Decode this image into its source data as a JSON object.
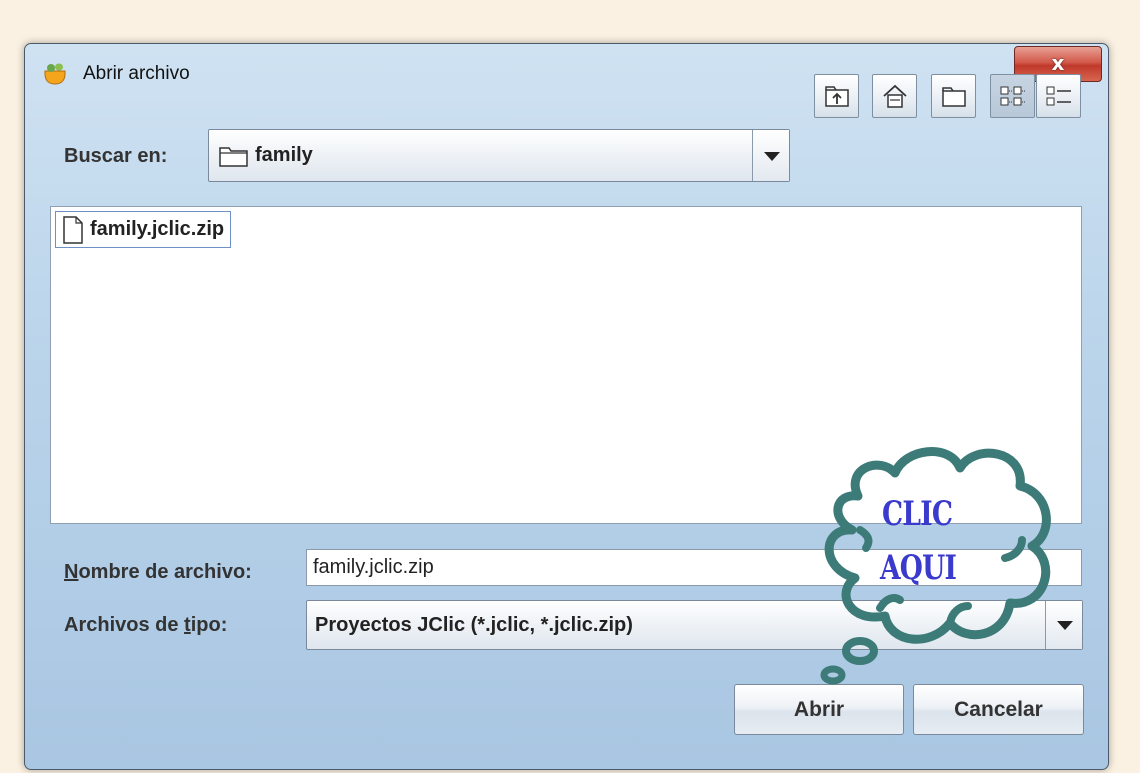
{
  "window": {
    "title": "Abrir archivo",
    "close_label": "x"
  },
  "lookin": {
    "label": "Buscar en:",
    "value": "family"
  },
  "toolbar": {
    "buttons": [
      {
        "icon": "up-folder-icon"
      },
      {
        "icon": "home-icon"
      },
      {
        "icon": "new-folder-icon"
      },
      {
        "icon": "list-view-icon",
        "pressed": true
      },
      {
        "icon": "details-view-icon"
      }
    ]
  },
  "files": [
    {
      "name": "family.jclic.zip",
      "icon": "file-icon"
    }
  ],
  "filename": {
    "label_first": "N",
    "label_rest": "ombre de archivo:",
    "value": "family.jclic.zip"
  },
  "filetype": {
    "label_pre": "Archivos de ",
    "label_underlined": "t",
    "label_post": "ipo:",
    "value": "Proyectos JClic (*.jclic, *.jclic.zip)"
  },
  "buttons": {
    "open": "Abrir",
    "cancel": "Cancelar"
  },
  "callout": {
    "line1": "CLIC",
    "line2": "AQUI",
    "color": "#3a3acd",
    "cloud_color": "#3d7b78"
  }
}
